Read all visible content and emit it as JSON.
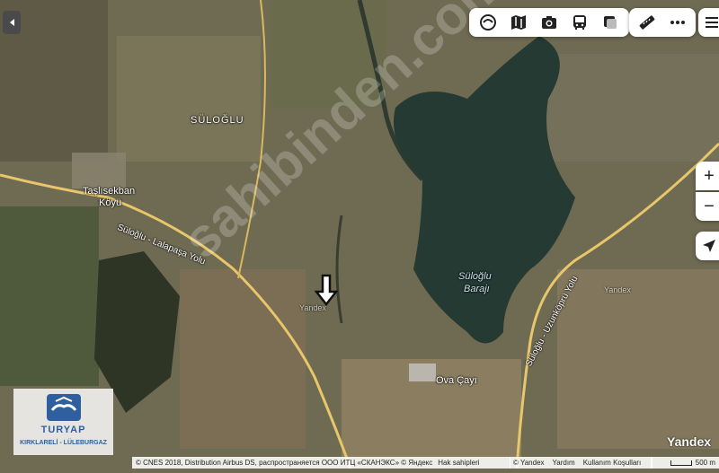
{
  "map": {
    "place_labels": {
      "suloglu": "SÜLOĞLU",
      "taslisekban": "Taşlısekban",
      "koyu": "Köyü",
      "road_suloglu_lalapasa": "Süloğlu - Lalapaşa Yolu",
      "suloglu_baraji_line1": "Süloğlu",
      "suloglu_baraji_line2": "Barajı",
      "road_suloglu_uzunkopru": "Süloğlu - Uzunköprü Yolu",
      "ova_cayi": "Ova Çayı",
      "yandex_watermark_1": "Yandex",
      "yandex_watermark_2": "Yandex"
    },
    "watermark_text": "sahibinden.com",
    "colors": {
      "water": "#243a33",
      "road": "#e8c66a",
      "terrain": "#6f6a52"
    }
  },
  "controls": {
    "back_icon": "caret-left-icon",
    "top_toolbar": [
      "layers-icon",
      "panorama-map-icon",
      "camera-icon",
      "bus-icon",
      "traffic-square-icon"
    ],
    "ruler_icon": "ruler-icon",
    "more_icon": "more-dots-icon",
    "menu_icon": "hamburger-menu-icon",
    "zoom_in": "+",
    "zoom_out": "−",
    "location_icon": "location-arrow-icon"
  },
  "logo": {
    "brand": "TURYAP",
    "subtitle": "KIRKLARELİ - LÜLEBURGAZ"
  },
  "footer": {
    "copyright": "© CNES 2018, Distribution Airbus DS, распространяется ООО ИТЦ «СКАНЭКС» © Яндекс",
    "rights_link": "Hak sahipleri",
    "yandex_copy": "© Yandex",
    "help_link": "Yardım",
    "terms_link": "Kullanım Koşulları",
    "scale": "500 m",
    "yandex_logo": "Yandex"
  }
}
